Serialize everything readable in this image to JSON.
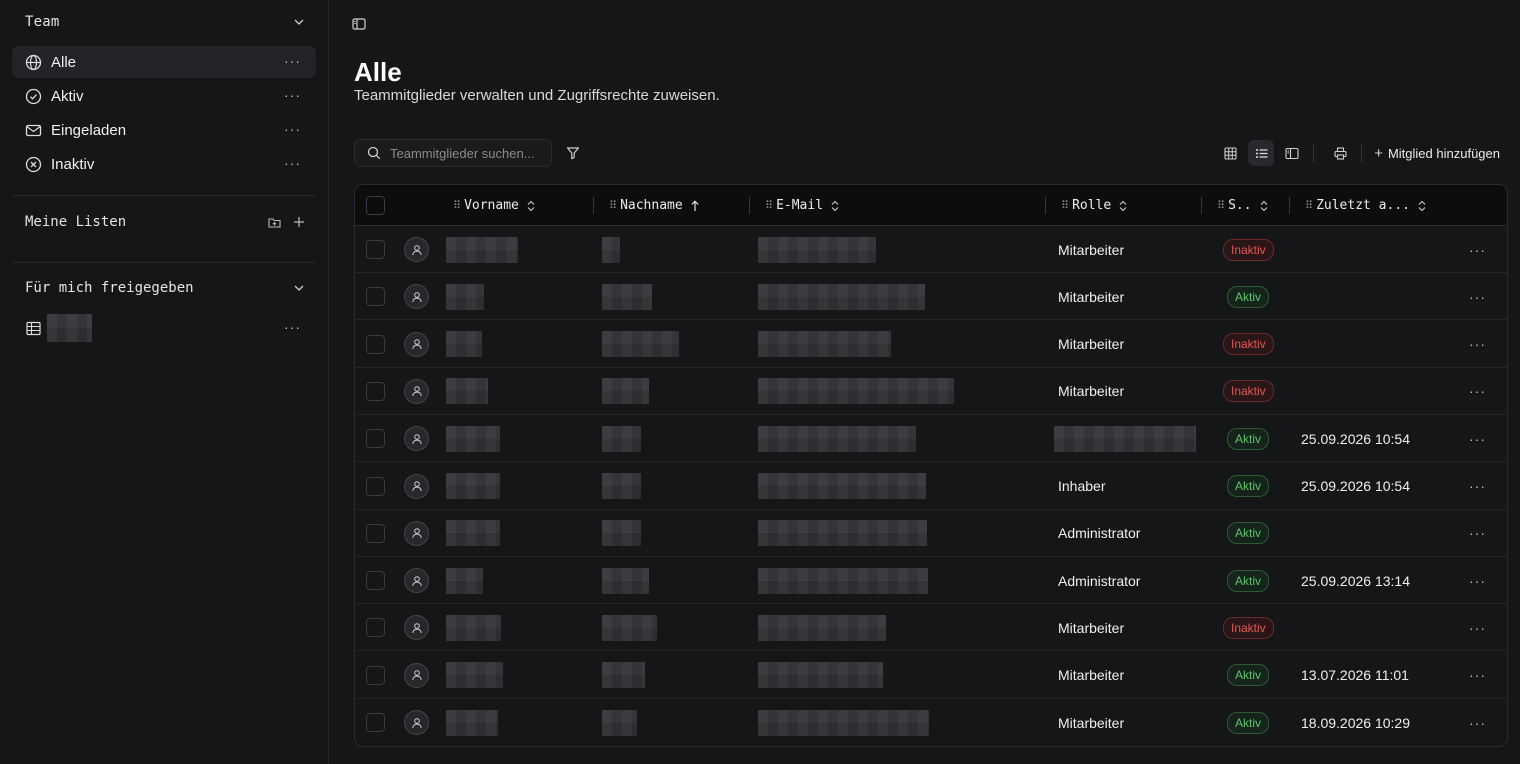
{
  "sidebar": {
    "header": "Team",
    "items": [
      {
        "label": "Alle",
        "icon": "globe-icon"
      },
      {
        "label": "Aktiv",
        "icon": "check-circle-icon"
      },
      {
        "label": "Eingeladen",
        "icon": "mail-icon"
      },
      {
        "label": "Inaktiv",
        "icon": "x-circle-icon"
      }
    ],
    "more": "···",
    "my_lists": "Meine Listen",
    "shared": "Für mich freigegeben"
  },
  "main": {
    "title": "Alle",
    "subtitle": "Teammitglieder verwalten und Zugriffsrechte zuweisen.",
    "search_placeholder": "Teammitglieder suchen...",
    "add_member": "Mitglied hinzufügen"
  },
  "table": {
    "columns": {
      "first_name": "Vorname",
      "last_name": "Nachname",
      "email": "E-Mail",
      "role": "Rolle",
      "status": "S..",
      "last": "Zuletzt a..."
    },
    "rows": [
      {
        "role": "Mitarbeiter",
        "status": "Inaktiv",
        "last": ""
      },
      {
        "role": "Mitarbeiter",
        "status": "Aktiv",
        "last": ""
      },
      {
        "role": "Mitarbeiter",
        "status": "Inaktiv",
        "last": ""
      },
      {
        "role": "Mitarbeiter",
        "status": "Inaktiv",
        "last": ""
      },
      {
        "role": "",
        "status": "Aktiv",
        "last": "25.09.2026 10:54"
      },
      {
        "role": "Inhaber",
        "status": "Aktiv",
        "last": "25.09.2026 10:54"
      },
      {
        "role": "Administrator",
        "status": "Aktiv",
        "last": ""
      },
      {
        "role": "Administrator",
        "status": "Aktiv",
        "last": "25.09.2026 13:14"
      },
      {
        "role": "Mitarbeiter",
        "status": "Inaktiv",
        "last": ""
      },
      {
        "role": "Mitarbeiter",
        "status": "Aktiv",
        "last": "13.07.2026 11:01"
      },
      {
        "role": "Mitarbeiter",
        "status": "Aktiv",
        "last": "18.09.2026 10:29"
      }
    ]
  },
  "colors": {
    "bg": "#151618",
    "active_green": "#5fc46a",
    "inactive_red": "#e05a57"
  }
}
